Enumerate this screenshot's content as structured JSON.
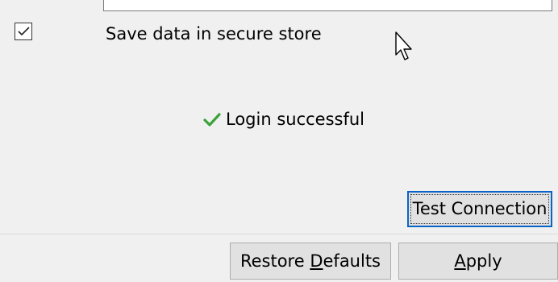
{
  "secure_store": {
    "checked": true,
    "label": "Save data in secure store"
  },
  "status": {
    "icon": "check-icon",
    "icon_color": "#3aa33a",
    "text": "Login successful"
  },
  "buttons": {
    "test_connection": "Test Connection",
    "restore_defaults": {
      "before": "Restore ",
      "mnemonic": "D",
      "after": "efaults"
    },
    "apply": {
      "before": "",
      "mnemonic": "A",
      "after": "pply"
    }
  },
  "colors": {
    "background": "#f0f0f0",
    "button_face": "#e1e1e1",
    "focus_border": "#0a64c8"
  }
}
